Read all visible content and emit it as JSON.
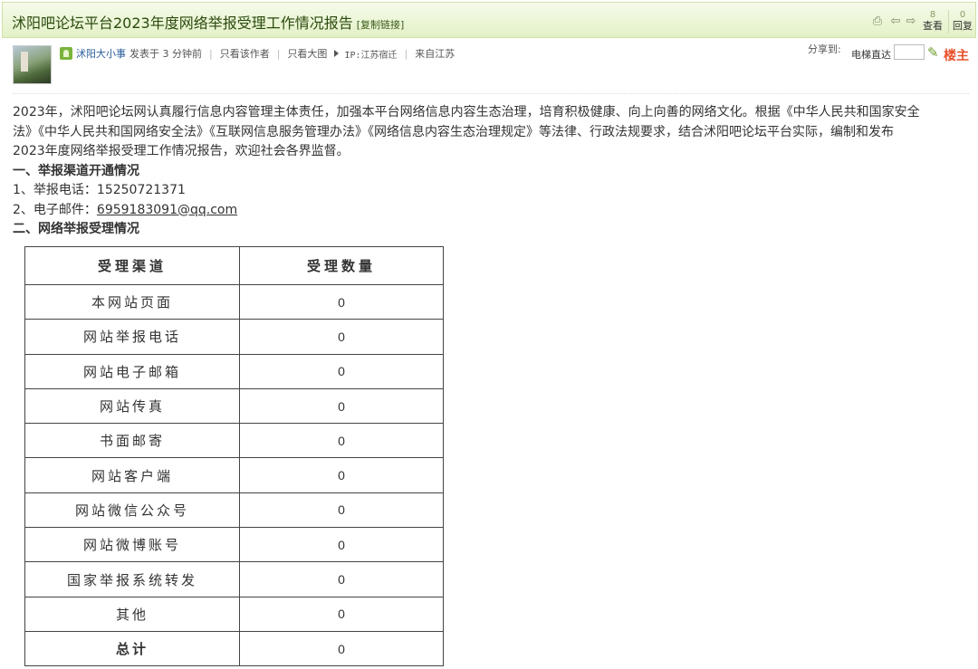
{
  "header": {
    "title": "沭阳吧论坛平台2023年度网络举报受理工作情况报告",
    "copy_link": "[复制链接]",
    "views_label": "查看",
    "views_count": "8",
    "replies_label": "回复",
    "replies_count": "0"
  },
  "author_bar": {
    "author": "沭阳大小事",
    "posted": "发表于 3 分钟前",
    "only_author": "只看该作者",
    "big_image": "只看大图",
    "ip": "IP:江苏宿迁",
    "from": "来自江苏",
    "share_label": "分享到:",
    "elevator_label": "电梯直达",
    "floor_label": "楼主"
  },
  "content": {
    "intro_lines": [
      "2023年，沭阳吧论坛网认真履行信息内容管理主体责任，加强本平台网络信息内容生态治理，培育积极健康、向上向善的网络文化。根据《中华人民共和国家安全",
      "法》《中华人民共和国网络安全法》《互联网信息服务管理办法》《网络信息内容生态治理规定》等法律、行政法规要求，结合沭阳吧论坛平台实际，编制和发布",
      "2023年度网络举报受理工作情况报告，欢迎社会各界监督。"
    ],
    "section1_title": "一、举报渠道开通情况",
    "phone_line": "1、举报电话：15250721371",
    "email_prefix": "2、电子邮件：",
    "email": "6959183091@qq.com",
    "section2_title": "二、网络举报受理情况"
  },
  "table": {
    "headers": [
      "受理渠道",
      "受理数量"
    ],
    "rows": [
      {
        "channel": "本网站页面",
        "count": "0"
      },
      {
        "channel": "网站举报电话",
        "count": "0"
      },
      {
        "channel": "网站电子邮箱",
        "count": "0"
      },
      {
        "channel": "网站传真",
        "count": "0"
      },
      {
        "channel": "书面邮寄",
        "count": "0"
      },
      {
        "channel": "网站客户端",
        "count": "0"
      },
      {
        "channel": "网站微信公众号",
        "count": "0"
      },
      {
        "channel": "网站微博账号",
        "count": "0"
      },
      {
        "channel": "国家举报系统转发",
        "count": "0"
      },
      {
        "channel": "其他",
        "count": "0"
      },
      {
        "channel": "总计",
        "count": "0"
      }
    ]
  }
}
